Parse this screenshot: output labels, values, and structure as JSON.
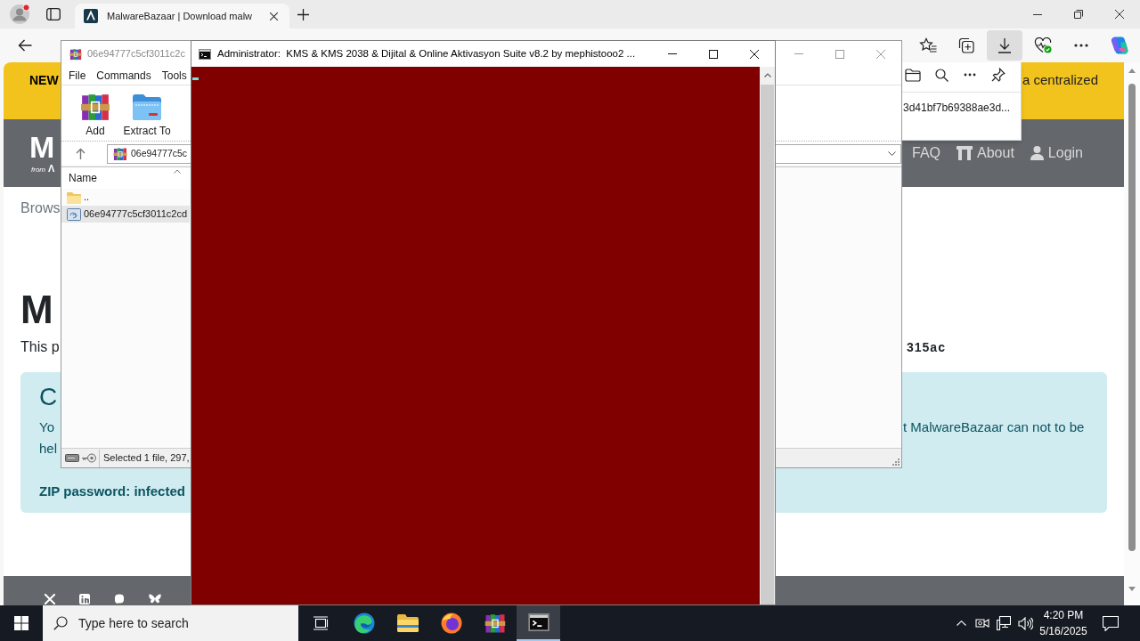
{
  "browser": {
    "tabs": [
      {
        "title": "MalwareBazaar | Download malw",
        "selected": true
      }
    ],
    "toolbar": [
      {
        "kind": "favorites",
        "selected": false
      },
      {
        "kind": "collections",
        "selected": false
      },
      {
        "kind": "downloads",
        "selected": true
      },
      {
        "kind": "performance",
        "selected": false
      },
      {
        "kind": "more",
        "selected": false
      },
      {
        "kind": "copilot",
        "selected": false
      }
    ]
  },
  "downloads_panel": {
    "file": "3d41bf7b69388ae3d..."
  },
  "page": {
    "banner": {
      "lead": "NEW",
      "tail": "a centralized"
    },
    "header": {
      "logo": "M",
      "logo_from": "from",
      "logo_mark": "Λ",
      "nav": [
        {
          "kind": "plain",
          "label": "FAQ"
        },
        {
          "kind": "building",
          "label": "About"
        },
        {
          "kind": "user",
          "label": "Login"
        }
      ]
    },
    "breadcrumb": "Brows",
    "heading": "M",
    "intro": "This p",
    "hash_tail": "315ac",
    "alert": {
      "title": "C",
      "line_1": "Yo",
      "line_1_tail": "t MalwareBazaar can not to be",
      "line_2": "hel",
      "password": "ZIP password: infected"
    }
  },
  "archiver": {
    "title": "06e94777c5cf3011c2c",
    "menu": [
      "File",
      "Commands",
      "Tools"
    ],
    "tools": [
      {
        "kind": "add",
        "label": "Add"
      },
      {
        "kind": "extract",
        "label": "Extract To"
      }
    ],
    "path": "06e94777c5c",
    "columns": [
      {
        "label": "Name",
        "sorted": true
      }
    ],
    "rows": [
      {
        "kind": "parent",
        "name": "..",
        "selected": false
      },
      {
        "kind": "archive",
        "name": "06e94777c5cf3011c2cd",
        "selected": true
      }
    ],
    "status": "Selected 1 file, 297,"
  },
  "console": {
    "title": "Administrator:  KMS & KMS 2038 & Dijital & Online Aktivasyon Suite v8.2 by mephistooo2 ..."
  },
  "taskbar": {
    "search": {
      "placeholder": "Type here to search"
    },
    "apps": [
      {
        "kind": "taskview",
        "selected": false
      },
      {
        "kind": "edge",
        "selected": false
      },
      {
        "kind": "explorer",
        "selected": false
      },
      {
        "kind": "firefox",
        "selected": false
      },
      {
        "kind": "winrar",
        "selected": false
      },
      {
        "kind": "console",
        "selected": true
      }
    ],
    "clock": {
      "time": "4:20 PM",
      "date": "5/16/2025"
    }
  }
}
